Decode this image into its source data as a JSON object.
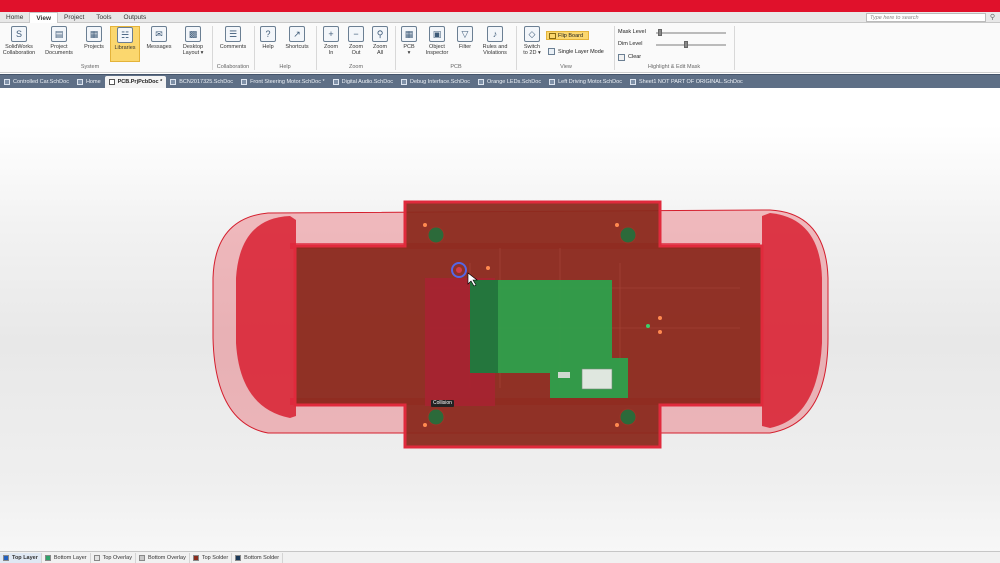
{
  "menu": {
    "tabs": [
      "Home",
      "View",
      "Project",
      "Tools",
      "Outputs"
    ],
    "active": "View",
    "search_placeholder": "Type here to search"
  },
  "ribbon": {
    "system": {
      "label": "System",
      "solidworks": "SolidWorks\nCollaboration",
      "project_documents": "Project\nDocuments",
      "projects": "Projects",
      "libraries": "Libraries",
      "messages": "Messages",
      "desktop_layout": "Desktop\nLayout ▾"
    },
    "collaboration": {
      "label": "Collaboration",
      "comments": "Comments"
    },
    "help": {
      "label": "Help",
      "help": "Help",
      "shortcuts": "Shortcuts"
    },
    "zoom": {
      "label": "Zoom",
      "zoom_in": "Zoom\nIn",
      "zoom_out": "Zoom\nOut",
      "zoom_all": "Zoom\nAll"
    },
    "pcb": {
      "label": "PCB",
      "pcb": "PCB\n▾",
      "object_inspector": "Object\nInspector",
      "filter": "Filter",
      "rules": "Rules and\nViolations"
    },
    "view": {
      "label": "View",
      "switch_2d": "Switch\nto 2D ▾",
      "flip_board": "Flip Board",
      "single_layer": "Single Layer Mode"
    },
    "highlight": {
      "label": "Highlight & Edit Mask",
      "mask_level": "Mask Level",
      "dim_level": "Dim Level",
      "clear": "Clear"
    }
  },
  "doc_tabs": [
    {
      "label": "Controlled Car.SchDoc",
      "active": false
    },
    {
      "label": "Home",
      "active": false
    },
    {
      "label": "PCB.PrjPcbDoc *",
      "active": true
    },
    {
      "label": "BCN2017325.SchDoc",
      "active": false
    },
    {
      "label": "Front Steering Motor.SchDoc *",
      "active": false
    },
    {
      "label": "Digital Audio.SchDoc",
      "active": false
    },
    {
      "label": "Debug Interface.SchDoc",
      "active": false
    },
    {
      "label": "Orange LEDs.SchDoc",
      "active": false
    },
    {
      "label": "Left Driving Motor.SchDoc",
      "active": false
    },
    {
      "label": "Sheet1 NOT PART OF ORIGINAL.SchDoc",
      "active": false
    }
  ],
  "canvas": {
    "collision_label": "Collision"
  },
  "layers": [
    {
      "label": "Top Layer",
      "color": "#1f5fbf",
      "active": true
    },
    {
      "label": "Bottom Layer",
      "color": "#2fa36b",
      "active": false
    },
    {
      "label": "Top Overlay",
      "color": "#e3e3e3",
      "active": false
    },
    {
      "label": "Bottom Overlay",
      "color": "#c8c8c8",
      "active": false
    },
    {
      "label": "Top Solder",
      "color": "#8a2c1d",
      "active": false
    },
    {
      "label": "Bottom Solder",
      "color": "#1c3a5a",
      "active": false
    }
  ],
  "colors": {
    "brand_bar": "#e0112b",
    "board": "#8b2a1e",
    "enclosure": "#e02a3c",
    "module": "#2ea04b"
  }
}
